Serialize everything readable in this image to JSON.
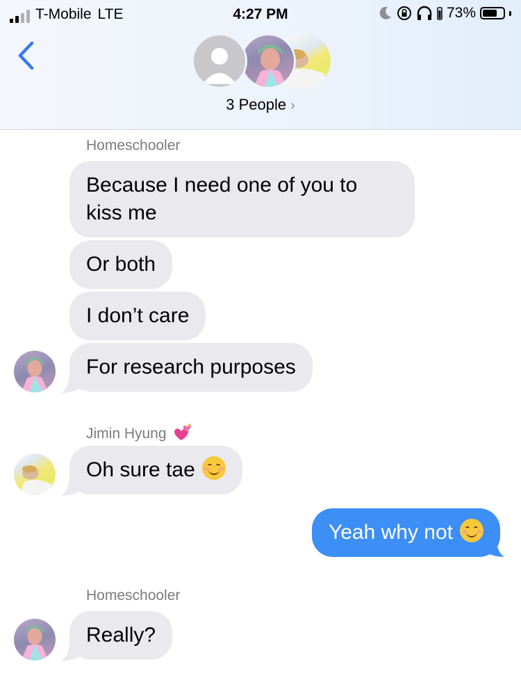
{
  "status_bar": {
    "carrier": "T-Mobile",
    "network": "LTE",
    "time": "4:27 PM",
    "battery": "73%",
    "battery_level": 0.73
  },
  "header": {
    "people_label": "3 People"
  },
  "messages": [
    {
      "sender": "Homeschooler",
      "text": "Because I need one of you to kiss me"
    },
    {
      "text": "Or both"
    },
    {
      "text": "I don’t care"
    },
    {
      "text": "For research purposes"
    },
    {
      "sender": "Jimin Hyung",
      "text": "Oh sure tae"
    },
    {
      "text": "Yeah why not",
      "outgoing": true
    },
    {
      "sender": "Homeschooler",
      "text": "Really?"
    }
  ],
  "colors": {
    "outgoing_bubble": "#3d8ef5",
    "incoming_bubble": "#e9e9ee",
    "accent": "#3478f6"
  },
  "icons": [
    "back-chevron-icon",
    "moon-icon",
    "rotation-lock-icon",
    "headphones-icon",
    "battery-icon",
    "sparkling-hearts-icon",
    "smiling-face-emoji"
  ]
}
